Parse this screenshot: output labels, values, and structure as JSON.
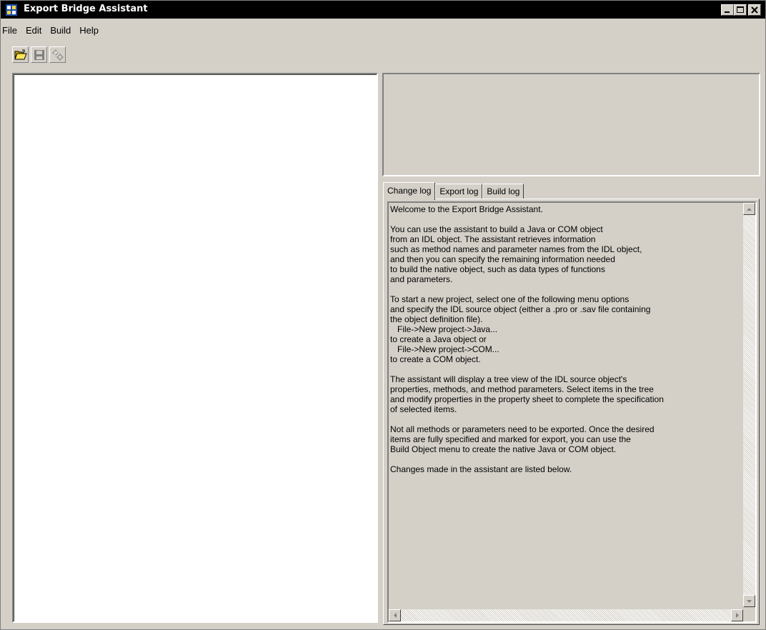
{
  "window": {
    "title": "Export Bridge Assistant",
    "controls": [
      "minimize-icon",
      "maximize-icon",
      "close-icon"
    ]
  },
  "menubar": {
    "items": [
      {
        "label": "File"
      },
      {
        "label": "Edit"
      },
      {
        "label": "Build"
      },
      {
        "label": "Help"
      }
    ]
  },
  "toolbar": {
    "buttons": [
      {
        "icon": "open-folder-icon",
        "enabled": true
      },
      {
        "icon": "save-icon",
        "enabled": false
      },
      {
        "icon": "build-icon",
        "enabled": false
      }
    ]
  },
  "tabs": [
    {
      "label": "Change log",
      "active": true
    },
    {
      "label": "Export log",
      "active": false
    },
    {
      "label": "Build log",
      "active": false
    }
  ],
  "log": {
    "text": "Welcome to the Export Bridge Assistant.\n\nYou can use the assistant to build a Java or COM object\nfrom an IDL object. The assistant retrieves information\nsuch as method names and parameter names from the IDL object,\nand then you can specify the remaining information needed\nto build the native object, such as data types of functions\nand parameters.\n\nTo start a new project, select one of the following menu options\nand specify the IDL source object (either a .pro or .sav file containing\nthe object definition file).\n   File->New project->Java...\nto create a Java object or\n   File->New project->COM...\nto create a COM object.\n\nThe assistant will display a tree view of the IDL source object's\nproperties, methods, and method parameters. Select items in the tree\nand modify properties in the property sheet to complete the specification\nof selected items.\n\nNot all methods or parameters need to be exported. Once the desired\nitems are fully specified and marked for export, you can use the\nBuild Object menu to create the native Java or COM object.\n\nChanges made in the assistant are listed below."
  },
  "colors": {
    "face": "#d4d0c8",
    "titlebar": "#000000",
    "tree_bg": "#ffffff"
  }
}
